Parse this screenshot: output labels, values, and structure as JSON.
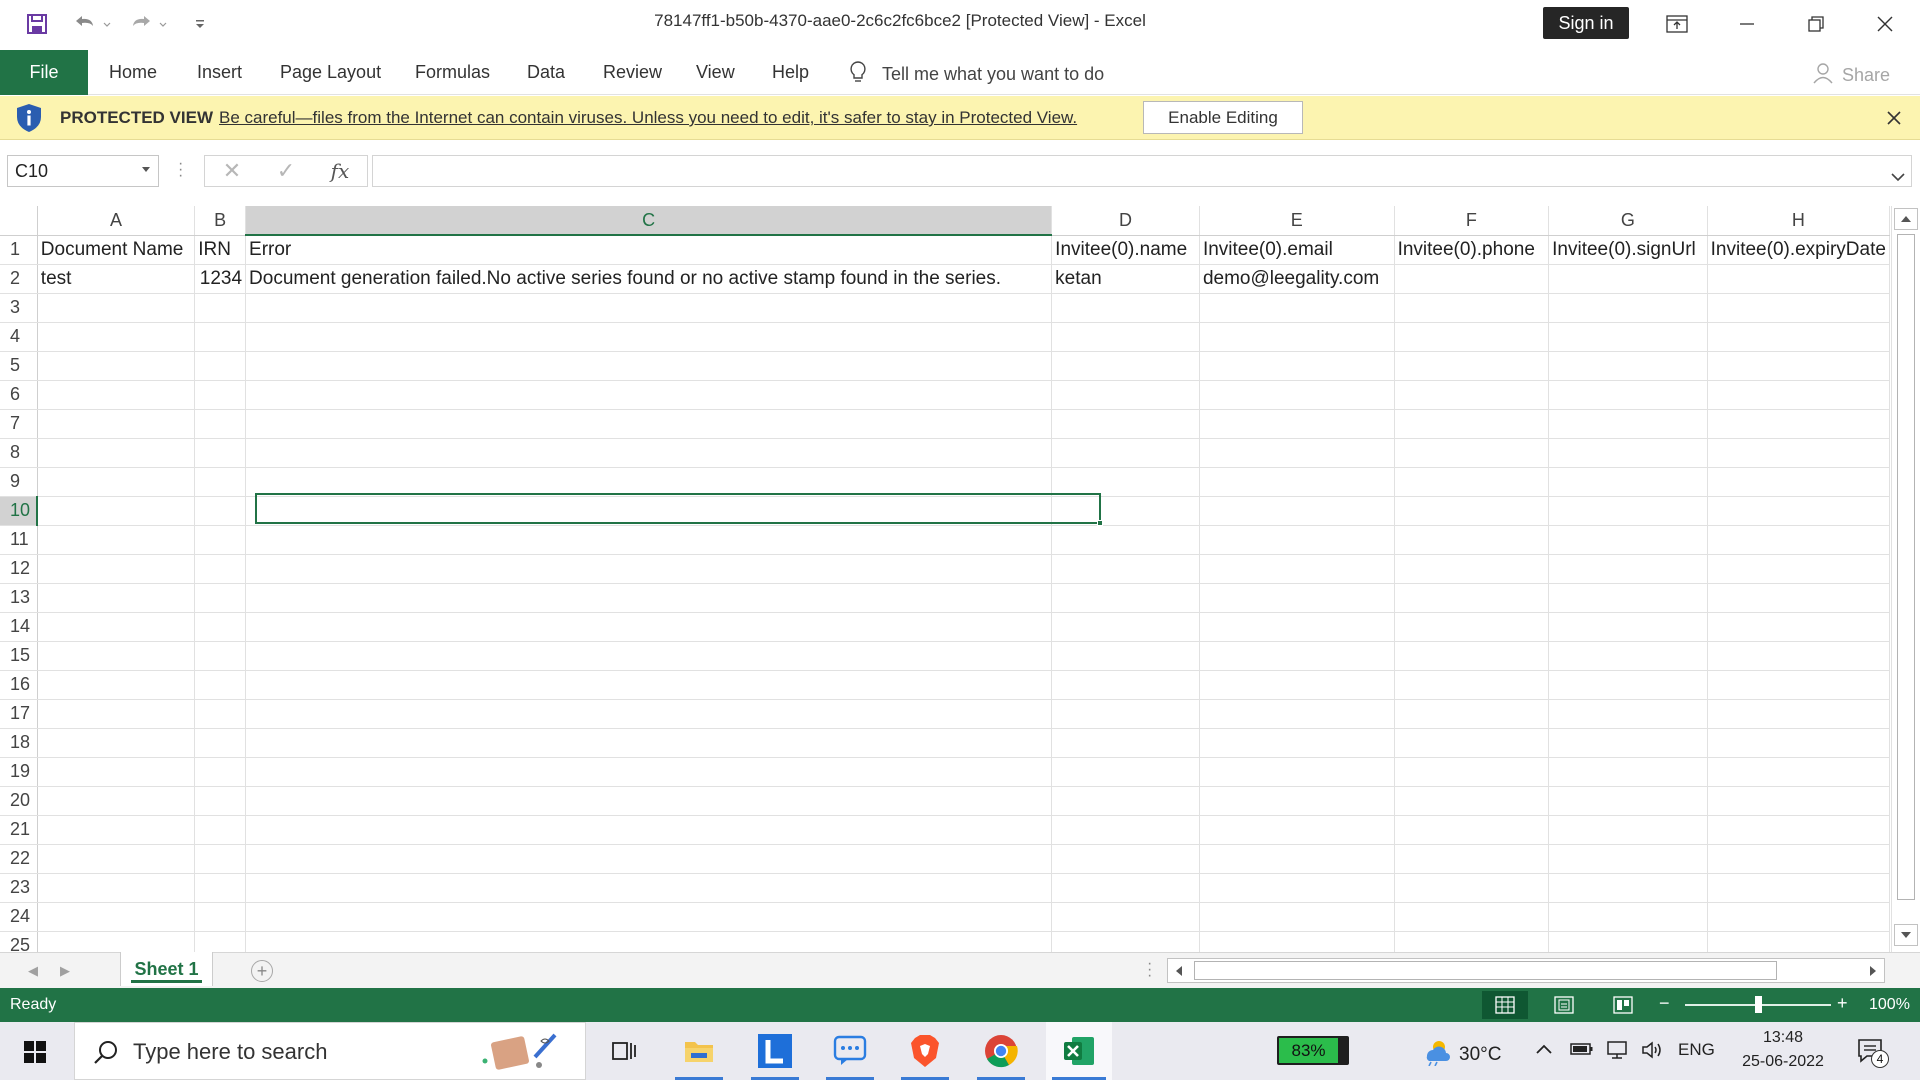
{
  "window": {
    "title": "78147ff1-b50b-4370-aae0-2c6c2fc6bce2  [Protected View]  -  Excel",
    "sign_in_label": "Sign in"
  },
  "ribbon": {
    "tabs": [
      "File",
      "Home",
      "Insert",
      "Page Layout",
      "Formulas",
      "Data",
      "Review",
      "View",
      "Help"
    ],
    "tell_me": "Tell me what you want to do",
    "share_label": "Share"
  },
  "protected_view": {
    "title": "PROTECTED VIEW",
    "message": "Be careful—files from the Internet can contain viruses. Unless you need to edit, it's safer to stay in Protected View.",
    "enable_button": "Enable Editing"
  },
  "formula_bar": {
    "name_box": "C10",
    "fx_label": "fx",
    "formula": ""
  },
  "sheet": {
    "columns": [
      "A",
      "B",
      "C",
      "D",
      "E",
      "F",
      "G",
      "H"
    ],
    "active_column": "C",
    "active_row": 10,
    "row_numbers": [
      "1",
      "2",
      "3",
      "4",
      "5",
      "6",
      "7",
      "8",
      "9",
      "10",
      "11",
      "12",
      "13",
      "14",
      "15",
      "16",
      "17",
      "18",
      "19",
      "20",
      "21",
      "22",
      "23",
      "24",
      "25"
    ],
    "rows": [
      [
        "Document Name",
        "IRN",
        "Error",
        "Invitee(0).name",
        "Invitee(0).email",
        "Invitee(0).phone",
        "Invitee(0).signUrl",
        "Invitee(0).expiryDate"
      ],
      [
        "test",
        "1234",
        "Document generation failed.No active series found or no active stamp found in the series.",
        "ketan",
        "demo@leegality.com",
        "",
        "",
        ""
      ]
    ]
  },
  "sheet_tabs": {
    "active_sheet": "Sheet 1"
  },
  "status_bar": {
    "status": "Ready",
    "zoom": "100%",
    "zoom_fraction": 0.5
  },
  "taskbar": {
    "search_placeholder": "Type here to search",
    "battery": "83%",
    "temperature": "30°C",
    "language": "ENG",
    "time": "13:48",
    "date": "25-06-2022",
    "notifications_count": "4"
  },
  "colors": {
    "excel_green": "#217346",
    "protected_bar": "#fcf4b0",
    "taskbar": "#eaeaf0"
  }
}
